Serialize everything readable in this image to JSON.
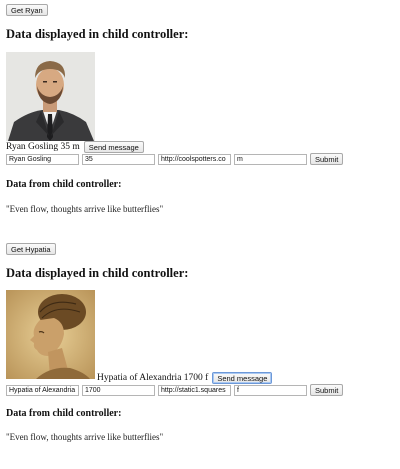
{
  "children": [
    {
      "get_button_label": "Get Ryan",
      "child_heading": "Data displayed in child controller:",
      "display_text": "Ryan Gosling 35 m",
      "send_button_label": "Send message",
      "form": {
        "name_value": "Ryan Gosling",
        "age_value": "35",
        "url_value": "http://coolspotters.co",
        "gender_value": "m",
        "submit_label": "Submit"
      },
      "from_child_heading": "Data from child controller:",
      "message": "\"Even flow, thoughts arrive like butterflies\""
    },
    {
      "get_button_label": "Get Hypatia",
      "child_heading": "Data displayed in child controller:",
      "display_text": "Hypatia of Alexandria 1700 f",
      "send_button_label": "Send message",
      "form": {
        "name_value": "Hypatia of Alexandria",
        "age_value": "1700",
        "url_value": "http://static1.squares",
        "gender_value": "f",
        "submit_label": "Submit"
      },
      "from_child_heading": "Data from child controller:",
      "message": "\"Even flow, thoughts arrive like butterflies\""
    }
  ]
}
